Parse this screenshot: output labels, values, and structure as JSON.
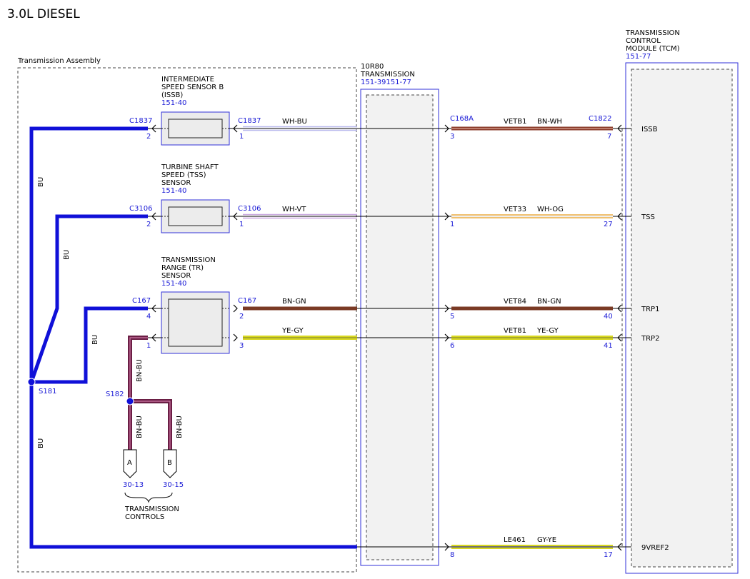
{
  "title": "3.0L DIESEL",
  "assembly_label": "Transmission Assembly",
  "transmission": {
    "lines": [
      "10R80",
      "TRANSMISSION"
    ],
    "ref": "151-39151-77"
  },
  "tcm": {
    "lines": [
      "TRANSMISSION",
      "CONTROL",
      "MODULE (TCM)"
    ],
    "ref": "151-77"
  },
  "sensors": [
    {
      "lines": [
        "INTERMEDIATE",
        "SPEED SENSOR B",
        "(ISSB)"
      ],
      "ref": "151-40"
    },
    {
      "lines": [
        "TURBINE SHAFT",
        "SPEED (TSS)",
        "SENSOR"
      ],
      "ref": "151-40"
    },
    {
      "lines": [
        "TRANSMISSION",
        "RANGE (TR)",
        "SENSOR"
      ],
      "ref": "151-40"
    }
  ],
  "connectors": {
    "issb_left": "C1837",
    "issb_right": "C1837",
    "tss_left": "C3106",
    "tss_right": "C3106",
    "tr_left": "C167",
    "tr_right": "C167",
    "trans": "C168A",
    "tcm": "C1822"
  },
  "pins": {
    "issb_left": "2",
    "issb_right": "1",
    "tss_left": "2",
    "tss_right": "1",
    "tr_left_top": "4",
    "tr_left_bot": "1",
    "tr_right_top": "2",
    "tr_right_bot": "3",
    "trans": [
      "3",
      "1",
      "5",
      "6",
      "8"
    ],
    "tcm": [
      "7",
      "27",
      "40",
      "41",
      "17"
    ]
  },
  "wires_left": [
    "WH-BU",
    "WH-VT",
    "BN-GN",
    "YE-GY"
  ],
  "circuits": [
    {
      "circuit": "VETB1",
      "color": "BN-WH",
      "signal": "ISSB"
    },
    {
      "circuit": "VET33",
      "color": "WH-OG",
      "signal": "TSS"
    },
    {
      "circuit": "VET84",
      "color": "BN-GN",
      "signal": "TRP1"
    },
    {
      "circuit": "VET81",
      "color": "YE-GY",
      "signal": "TRP2"
    },
    {
      "circuit": "LE461",
      "color": "GY-YE",
      "signal": "9VREF2"
    }
  ],
  "bus_labels": {
    "bu": "BU",
    "bnbu": "BN-BU"
  },
  "splices": {
    "s181": "S181",
    "s182": "S182"
  },
  "controls": {
    "a": "A",
    "b": "B",
    "ref_a": "30-13",
    "ref_b": "30-15",
    "lines": [
      "TRANSMISSION",
      "CONTROLS"
    ]
  },
  "colors": {
    "bu": "#1010d8",
    "bn": "#7a3a24",
    "bnbu": "#6a1e44",
    "ye": "#d8d820",
    "accent": "#1a1ad6"
  }
}
